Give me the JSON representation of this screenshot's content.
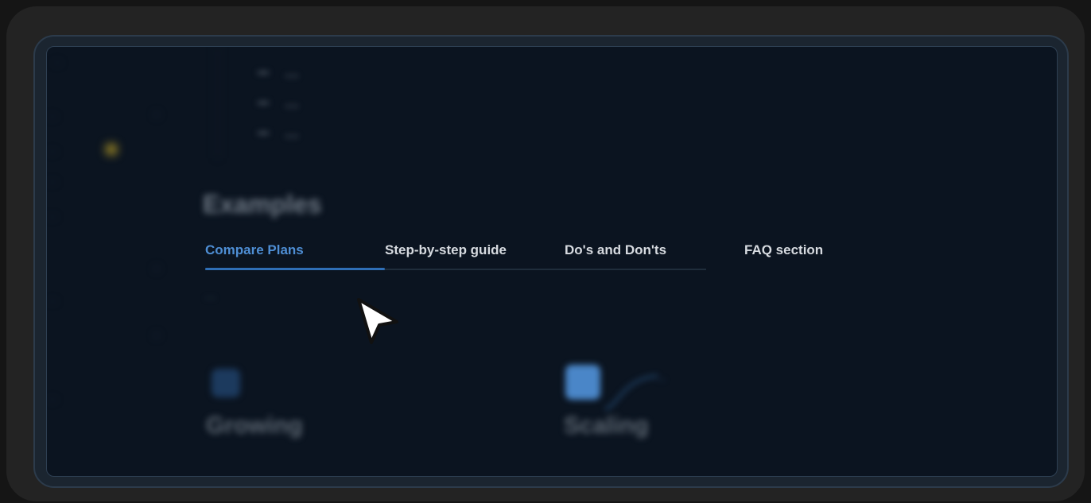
{
  "sidebar": {
    "items": [
      "…",
      "…",
      "…",
      "…",
      "…",
      "…",
      "…",
      "…"
    ]
  },
  "doc": {
    "bullets": [
      "…",
      "…",
      "…"
    ],
    "section_title": "Examples",
    "paragraph": "…",
    "features": [
      {
        "title": "Growing",
        "icon": "feature-icon"
      },
      {
        "title": "Scaling",
        "icon": "feature-icon",
        "link": "…"
      }
    ]
  },
  "tabs": [
    {
      "label": "Compare Plans",
      "active": true
    },
    {
      "label": "Step-by-step guide",
      "active": false
    },
    {
      "label": "Do's and Don'ts",
      "active": false
    },
    {
      "label": "FAQ section",
      "active": false
    }
  ],
  "colors": {
    "active_tab": "#4e8ed4",
    "tab_text": "#d7dbe0",
    "screen_bg": "#0b1420"
  },
  "cursor_icon": "pointer-arrow-icon"
}
